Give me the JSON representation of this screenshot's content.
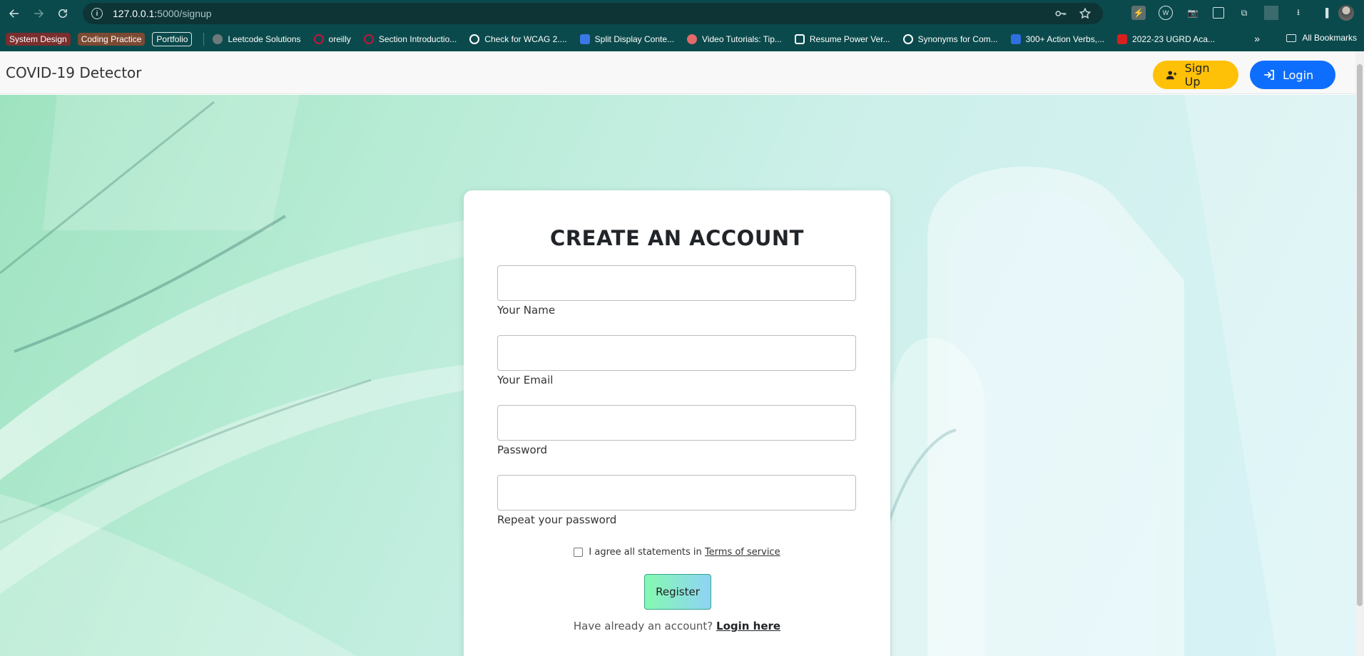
{
  "browser": {
    "url_host": "127.0.0.1:",
    "url_rest": "5000/signup"
  },
  "bookmarks": {
    "chips": [
      "System Design",
      "Coding Practice",
      "Portfolio"
    ],
    "items": [
      {
        "label": "Leetcode Solutions",
        "color": "#6c7a7a"
      },
      {
        "label": "oreilly",
        "color": "#c0163a"
      },
      {
        "label": "Section Introductio...",
        "color": "#c0163a"
      },
      {
        "label": "Check for WCAG 2....",
        "color": "#ffffff"
      },
      {
        "label": "Split Display Conte...",
        "color": "#3b78e7"
      },
      {
        "label": "Video Tutorials: Tip...",
        "color": "#e36a6a"
      },
      {
        "label": "Resume Power Ver...",
        "color": "#ffffff"
      },
      {
        "label": "Synonyms for Com...",
        "color": "#ffffff"
      },
      {
        "label": "300+ Action Verbs,...",
        "color": "#2f6fe0"
      },
      {
        "label": "2022-23 UGRD Aca...",
        "color": "#d6201f"
      }
    ],
    "more": "»",
    "all_bookmarks": "All Bookmarks"
  },
  "navbar": {
    "brand": "COVID-19 Detector",
    "signup_label": "Sign Up",
    "login_label": "Login"
  },
  "form": {
    "title": "CREATE AN ACCOUNT",
    "name_label": "Your Name",
    "email_label": "Your Email",
    "password_label": "Password",
    "repeat_label": "Repeat your password",
    "terms_text": "I agree all statements in",
    "terms_link": "Terms of service",
    "register_label": "Register",
    "have_account_text": "Have already an account?",
    "login_link": "Login here"
  },
  "colors": {
    "signup_button": "#ffc107",
    "login_button": "#0d6efd",
    "browser_chrome": "#0b4a4c"
  }
}
